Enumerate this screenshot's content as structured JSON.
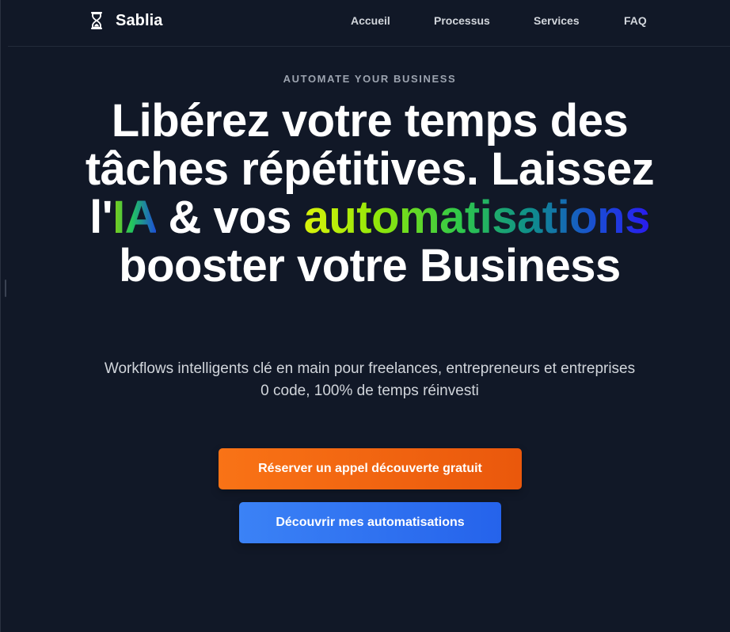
{
  "header": {
    "brand_name": "Sablia",
    "brand_icon": "hourglass-icon",
    "nav": [
      {
        "label": "Accueil"
      },
      {
        "label": "Processus"
      },
      {
        "label": "Services"
      },
      {
        "label": "FAQ"
      }
    ]
  },
  "hero": {
    "eyebrow": "AUTOMATE YOUR BUSINESS",
    "headline": {
      "part1": "Libérez votre temps des tâches répétitives. Laissez l'",
      "highlight_ia": "IA",
      "part2": " & vos ",
      "highlight_auto": "automatisations",
      "part3": " booster votre Business"
    },
    "subtitle_line1": "Workflows intelligents clé en main pour freelances, entrepreneurs et entreprises",
    "subtitle_line2": "0 code, 100% de temps réinvesti",
    "primary_button": "Réserver un appel découverte gratuit",
    "secondary_button": "Découvrir mes automatisations"
  },
  "colors": {
    "background": "#111827",
    "primary_button": "#f97316",
    "secondary_button": "#3b82f6",
    "nav_text": "#d1d5db",
    "eyebrow_text": "#9ca3af"
  }
}
